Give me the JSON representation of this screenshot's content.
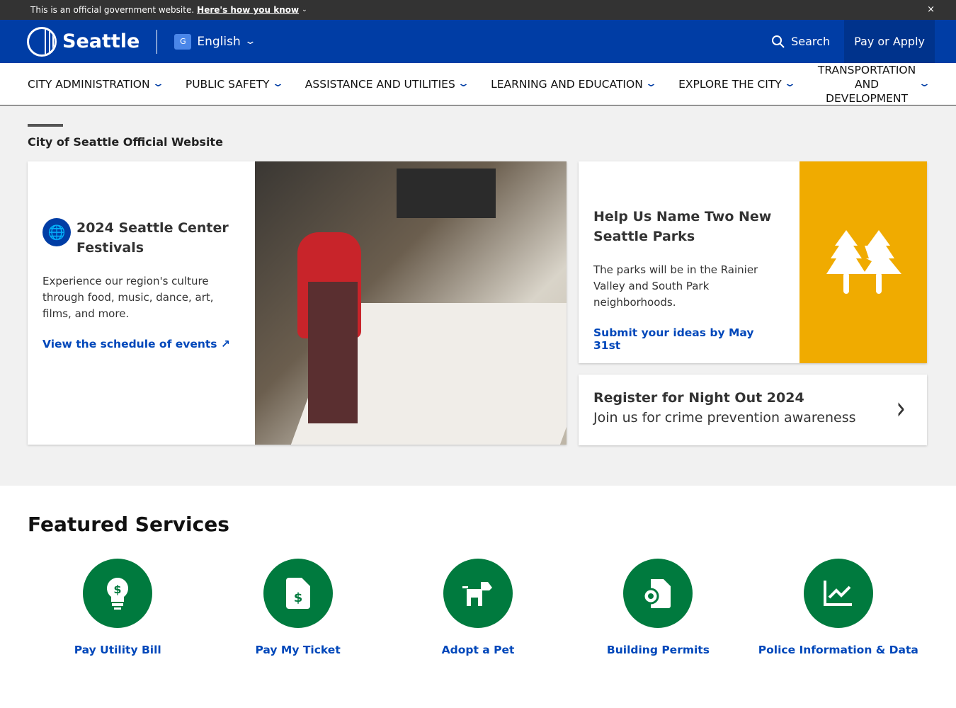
{
  "banner": {
    "text": "This is an official government website.",
    "link": "Here's how you know",
    "close": "×"
  },
  "header": {
    "logo": "Seattle",
    "language": "English",
    "search": "Search",
    "pay": "Pay or Apply"
  },
  "nav": [
    {
      "label": "City Administration"
    },
    {
      "label": "Public Safety"
    },
    {
      "label": "Assistance and Utilities"
    },
    {
      "label": "Learning and Education"
    },
    {
      "label": "Explore the City"
    },
    {
      "label": "Transportation and Development"
    }
  ],
  "subtitle": "City of Seattle Official Website",
  "feature1": {
    "title": "2024 Seattle Center Festivals",
    "text": "Experience our region's culture through food, music, dance, art, films, and more.",
    "link": "View the schedule of events"
  },
  "feature2": {
    "title": "Help Us Name Two New Seattle Parks",
    "text": "The parks will be in the Rainier Valley and South Park neighborhoods.",
    "link": "Submit your ideas by May 31st"
  },
  "feature3": {
    "title": "Register for Night Out 2024",
    "text": "Join us for crime prevention awareness"
  },
  "featured": {
    "title": "Featured Services",
    "items": [
      {
        "label": "Pay Utility Bill",
        "icon": "lightbulb-dollar-icon"
      },
      {
        "label": "Pay My Ticket",
        "icon": "document-dollar-icon"
      },
      {
        "label": "Adopt a Pet",
        "icon": "pet-icon"
      },
      {
        "label": "Building Permits",
        "icon": "permit-icon"
      },
      {
        "label": "Police Information & Data",
        "icon": "chart-line-icon"
      }
    ]
  },
  "colors": {
    "brand": "#003da5",
    "accent": "#f0ab00",
    "services": "#007a3e",
    "link": "#0047ba"
  }
}
